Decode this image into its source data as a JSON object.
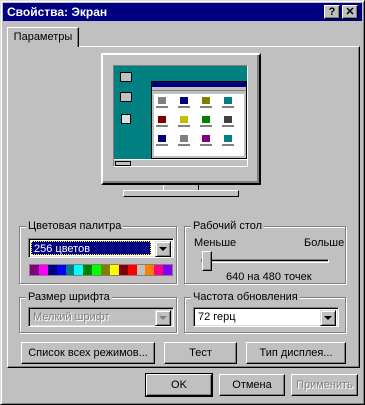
{
  "window": {
    "title": "Свойства: Экран",
    "help_glyph": "?",
    "close_glyph": "✕"
  },
  "tabs": [
    {
      "label": "Параметры",
      "active": true
    }
  ],
  "color_palette": {
    "label": "Цветовая палитра",
    "selected": "256 цветов",
    "swatches": [
      "#800080",
      "#ff00ff",
      "#000080",
      "#0000ff",
      "#008080",
      "#00ffff",
      "#008000",
      "#00ff00",
      "#808000",
      "#ffff00",
      "#800000",
      "#ff0000",
      "#c0c0c0",
      "#ff8000",
      "#ff0080",
      "#8000ff"
    ]
  },
  "desktop_area": {
    "label": "Рабочий стол",
    "min_label": "Меньше",
    "max_label": "Больше",
    "resolution": "640 на 480 точек",
    "slider_fraction": 0.0
  },
  "font_size": {
    "label": "Размер шрифта",
    "selected": "Мелкий шрифт",
    "enabled": false
  },
  "refresh_rate": {
    "label": "Частота обновления",
    "selected": "72 герц"
  },
  "panel_buttons": {
    "modes": "Список всех режимов...",
    "test": "Тест",
    "display_type": "Тип дисплея..."
  },
  "dialog_buttons": {
    "ok": "OK",
    "cancel": "Отмена",
    "apply": "Применить"
  },
  "colors": {
    "title_bar": "#000080",
    "face": "#c0c0c0",
    "desktop": "#008080"
  }
}
